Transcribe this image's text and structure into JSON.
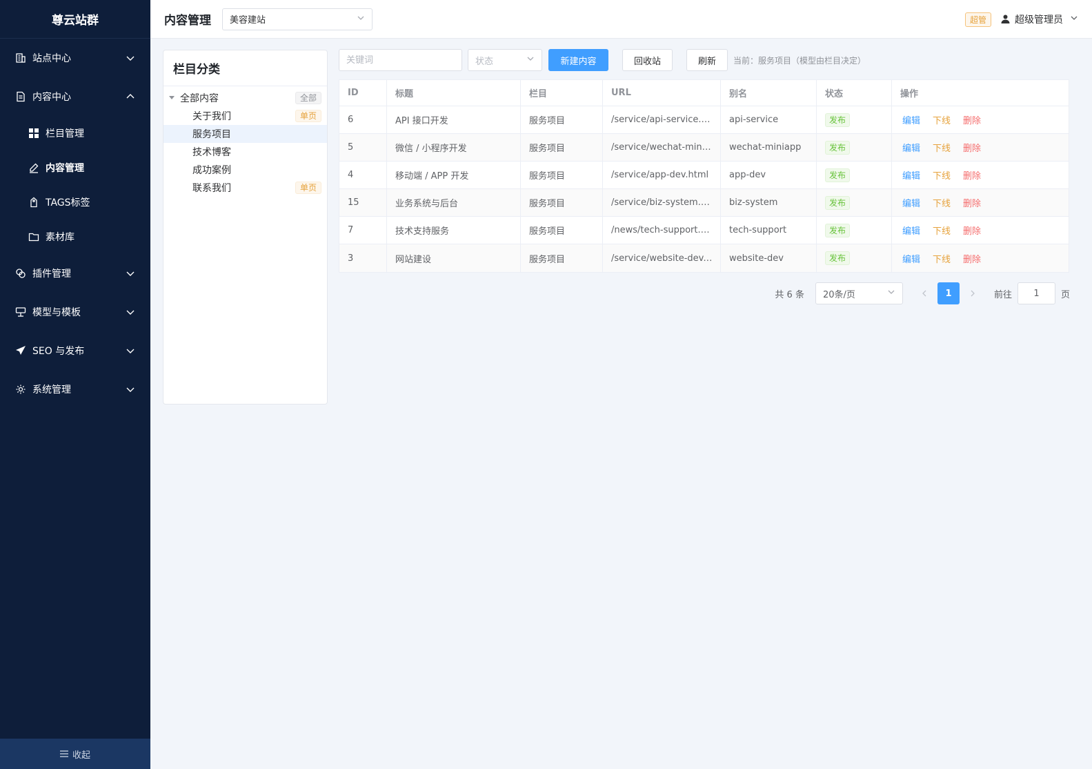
{
  "sidebar": {
    "brand": "尊云站群",
    "groups": [
      {
        "label": "站点中心",
        "expanded": false
      },
      {
        "label": "内容中心",
        "expanded": true
      },
      {
        "label": "插件管理",
        "expanded": false
      },
      {
        "label": "模型与模板",
        "expanded": false
      },
      {
        "label": "SEO 与发布",
        "expanded": false
      },
      {
        "label": "系统管理",
        "expanded": false
      }
    ],
    "content_items": [
      {
        "label": "栏目管理",
        "icon": "grid-icon"
      },
      {
        "label": "内容管理",
        "icon": "pen-icon",
        "active": true
      },
      {
        "label": "TAGS标签",
        "icon": "tag-icon"
      },
      {
        "label": "素材库",
        "icon": "folder-icon"
      }
    ],
    "collapse_label": "收起"
  },
  "header": {
    "title": "内容管理",
    "site_select": "美容建站",
    "role_badge": "超管",
    "user_name": "超级管理员"
  },
  "category_panel": {
    "title": "栏目分类",
    "root": {
      "label": "全部内容",
      "tag": "全部"
    },
    "children": [
      {
        "label": "关于我们",
        "tag": "单页"
      },
      {
        "label": "服务项目",
        "tag": "",
        "selected": true
      },
      {
        "label": "技术博客",
        "tag": ""
      },
      {
        "label": "成功案例",
        "tag": ""
      },
      {
        "label": "联系我们",
        "tag": "单页"
      }
    ]
  },
  "toolbar": {
    "keyword_placeholder": "关键词",
    "status_placeholder": "状态",
    "new_label": "新建内容",
    "recycle_label": "回收站",
    "refresh_label": "刷新",
    "current_hint": "当前：服务项目（模型由栏目决定）"
  },
  "table": {
    "headers": [
      "ID",
      "标题",
      "栏目",
      "URL",
      "别名",
      "状态",
      "操作"
    ],
    "rows": [
      {
        "id": "6",
        "title": "API 接口开发",
        "column": "服务项目",
        "url": "/service/api-service.html",
        "alias": "api-service",
        "status": "发布"
      },
      {
        "id": "5",
        "title": "微信 / 小程序开发",
        "column": "服务项目",
        "url": "/service/wechat-miniapp.html",
        "alias": "wechat-miniapp",
        "status": "发布"
      },
      {
        "id": "4",
        "title": "移动端 / APP 开发",
        "column": "服务项目",
        "url": "/service/app-dev.html",
        "alias": "app-dev",
        "status": "发布"
      },
      {
        "id": "15",
        "title": "业务系统与后台",
        "column": "服务项目",
        "url": "/service/biz-system.html",
        "alias": "biz-system",
        "status": "发布"
      },
      {
        "id": "7",
        "title": "技术支持服务",
        "column": "服务项目",
        "url": "/news/tech-support.html",
        "alias": "tech-support",
        "status": "发布"
      },
      {
        "id": "3",
        "title": "网站建设",
        "column": "服务项目",
        "url": "/service/website-dev.html",
        "alias": "website-dev",
        "status": "发布"
      }
    ],
    "ops": {
      "edit": "编辑",
      "offline": "下线",
      "delete": "删除"
    }
  },
  "pagination": {
    "total": "共 6 条",
    "page_size": "20条/页",
    "current_page": "1",
    "goto_label": "前往",
    "goto_value": "1",
    "goto_suffix": "页"
  },
  "colors": {
    "sidebar_bg": "#0e1e3a",
    "primary": "#409eff",
    "warning": "#e6a23c",
    "danger": "#f56c6c",
    "success": "#67c23a"
  }
}
